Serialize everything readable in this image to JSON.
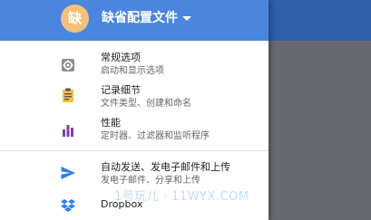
{
  "header": {
    "avatar_char": "缺",
    "title": "缺省配置文件"
  },
  "menu": {
    "items": [
      {
        "title": "常规选项",
        "subtitle": "启动和显示选项",
        "icon": "gear-icon"
      },
      {
        "title": "记录细节",
        "subtitle": "文件类型、创建和命名",
        "icon": "clipboard-icon"
      },
      {
        "title": "性能",
        "subtitle": "定时器、过滤器和监听程序",
        "icon": "bar-chart-icon"
      },
      {
        "title": "自动发送、发电子邮件和上传",
        "subtitle": "发电子邮件、分享和上传",
        "icon": "send-icon"
      },
      {
        "title": "Dropbox",
        "subtitle": "",
        "icon": "dropbox-icon"
      }
    ]
  },
  "watermark": "1号玩儿 · 11WYX.COM",
  "colors": {
    "header_bg": "#4a86e0",
    "avatar_bg": "#f4c07a",
    "icon_gray": "#8a8f96",
    "icon_purple": "#7b3fb0",
    "icon_blue": "#2f7ee8",
    "icon_yellow": "#f0c040"
  }
}
